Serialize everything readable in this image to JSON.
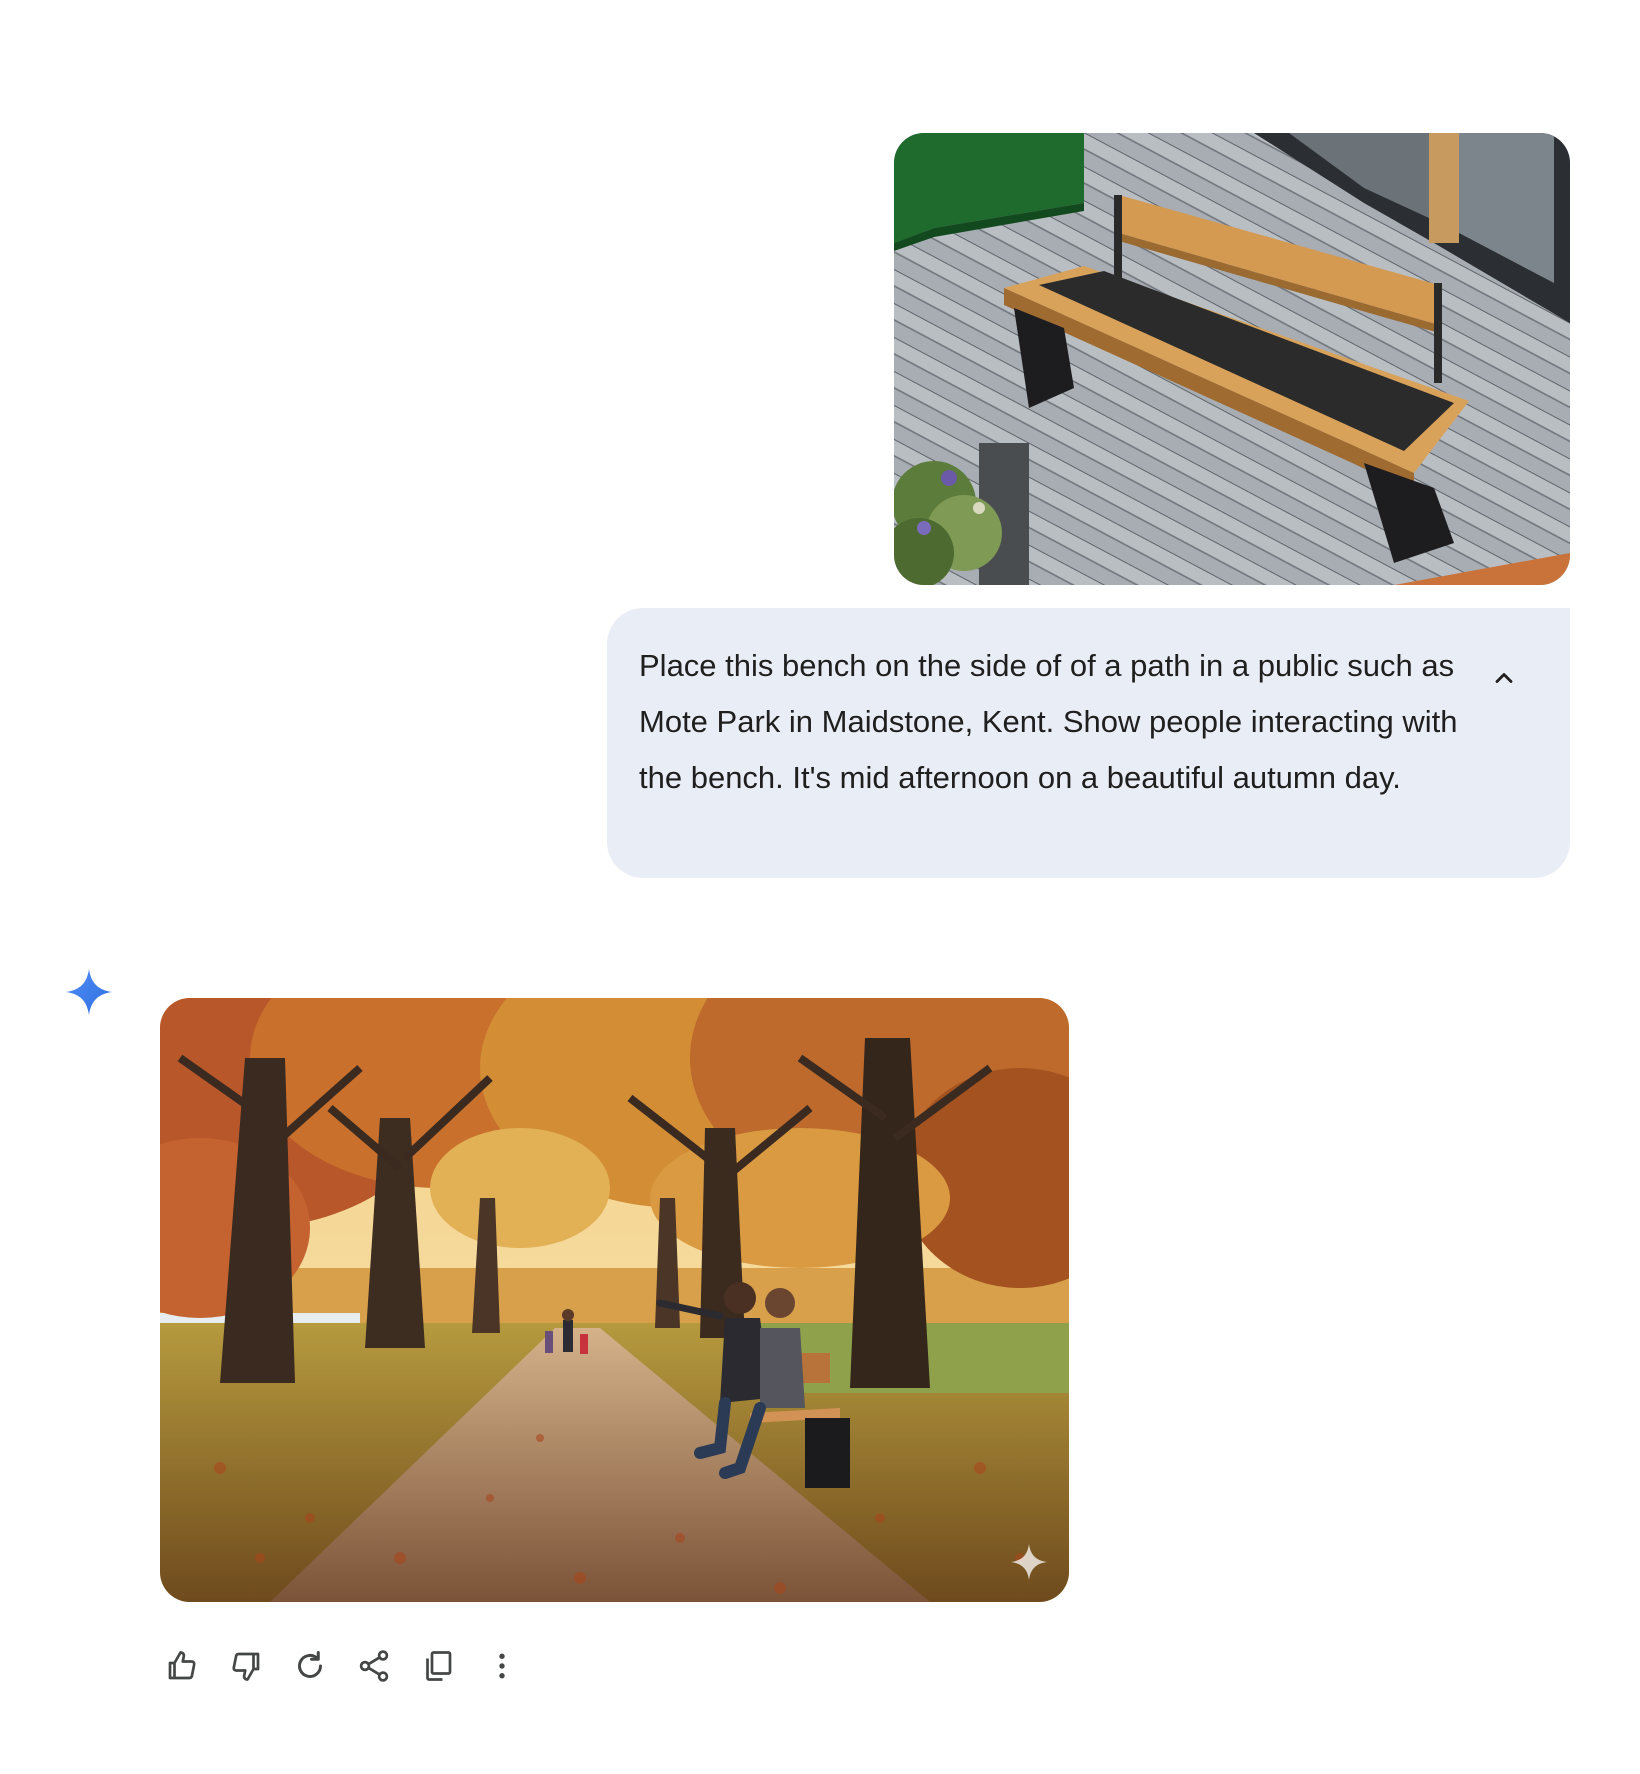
{
  "conversation": {
    "user_message": {
      "image": {
        "description_icon": "uploaded-bench-photo"
      },
      "prompt_text": "Place this bench on the side of of a path in a public such as Mote Park in Maidstone, Kent. Show people interacting with the bench. It's mid afternoon on a beautiful autumn day.",
      "collapse_icon": "chevron-up-icon"
    },
    "assistant_message": {
      "avatar_icon": "gemini-sparkle-icon",
      "image": {
        "description_icon": "generated-autumn-park-photo"
      },
      "watermark_icon": "sparkle-watermark-icon"
    },
    "actions": [
      {
        "id": "good-response",
        "icon": "thumb-up-icon"
      },
      {
        "id": "bad-response",
        "icon": "thumb-down-icon"
      },
      {
        "id": "regenerate",
        "icon": "refresh-icon"
      },
      {
        "id": "share",
        "icon": "share-icon"
      },
      {
        "id": "copy",
        "icon": "copy-icon"
      },
      {
        "id": "more",
        "icon": "more-vert-icon"
      }
    ]
  },
  "colors": {
    "bubble_bg": "#e9edf5",
    "text": "#1f1f1f",
    "icon": "#444746",
    "gemini_blue": "#4285f4"
  }
}
